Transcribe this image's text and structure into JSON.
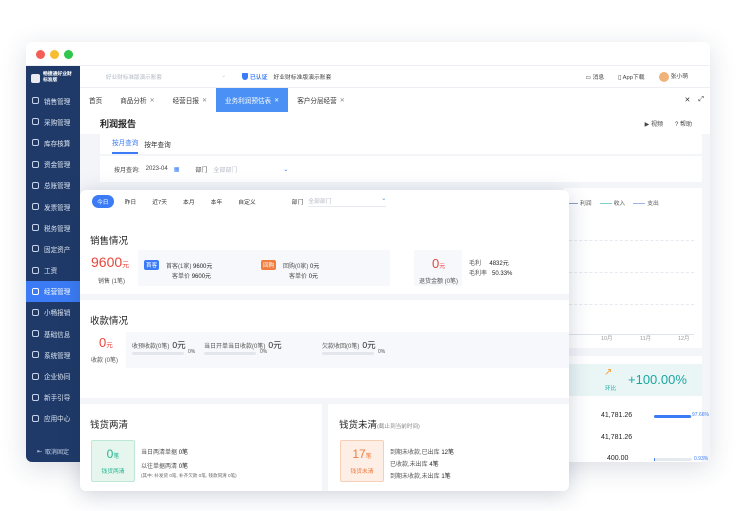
{
  "sidebar": {
    "logo_line1": "畅捷通好业财",
    "logo_line2": "标准版",
    "items": [
      {
        "label": "销售管理"
      },
      {
        "label": "采购管理"
      },
      {
        "label": "库存核算"
      },
      {
        "label": "资金管理"
      },
      {
        "label": "总账管理"
      },
      {
        "label": "发票管理"
      },
      {
        "label": "税务管理"
      },
      {
        "label": "固定资产"
      },
      {
        "label": "工资"
      },
      {
        "label": "经营管理"
      },
      {
        "label": "小畅报销"
      },
      {
        "label": "基础信息"
      },
      {
        "label": "系统管理"
      },
      {
        "label": "企业协同"
      },
      {
        "label": "新手引导"
      },
      {
        "label": "应用中心"
      }
    ],
    "active_index": 9,
    "footer": "取消固定"
  },
  "topbar": {
    "account_select": "好业财标准版演示账套",
    "certified": "已认证",
    "demo_name": "好业财标准版演示账套",
    "messages": "消息",
    "app_download": "App下载",
    "user_name": "张小萌"
  },
  "tabs": [
    {
      "label": "首页",
      "closable": false
    },
    {
      "label": "商品分析",
      "closable": true
    },
    {
      "label": "经营日报",
      "closable": true
    },
    {
      "label": "业务利润预估表",
      "closable": true,
      "active": true
    },
    {
      "label": "客户分层经营",
      "closable": true
    }
  ],
  "report": {
    "title": "利润报告",
    "video": "视频",
    "help": "帮助",
    "sub_tabs": [
      "按月查询",
      "按年查询"
    ],
    "filter_label": "按月查询:",
    "filter_month": "2023-04",
    "dept_label": "部门",
    "dept_placeholder": "全部部门"
  },
  "background_chart": {
    "legend": [
      "利润",
      "收入",
      "支出"
    ],
    "x_ticks": [
      "10月",
      "11月",
      "12月"
    ]
  },
  "background_stats": {
    "ratio_label": "环比",
    "ratio_value": "+100.00%",
    "rows": [
      {
        "value": "41,781.26",
        "pct": "97.66%",
        "fraction": 0.9766
      },
      {
        "value": "41,781.26",
        "pct": "",
        "fraction": 0
      },
      {
        "value": "400.00",
        "pct": "0.93%",
        "fraction": 0.0093
      }
    ]
  },
  "dashboard": {
    "periods": [
      "今日",
      "昨日",
      "近7天",
      "本月",
      "本年",
      "自定义"
    ],
    "active_period": 0,
    "dept_label": "部门",
    "dept_placeholder": "全部部门",
    "sales": {
      "title": "销售情况",
      "amount_num": "9600",
      "amount_unit": "元",
      "amount_sub": "销售 (1笔)",
      "tag_first": "首客",
      "first_label": "首客(1家)",
      "first_value": "9600元",
      "first_price_label": "客单价",
      "first_price": "9600元",
      "tag_repeat": "回购",
      "repeat_label": "回购(0家)",
      "repeat_value": "0元",
      "repeat_price_label": "客单价",
      "repeat_price": "0元",
      "return_num": "0",
      "return_unit": "元",
      "return_sub": "退货金额 (0笔)",
      "gross_profit_label": "毛利",
      "gross_profit": "4832元",
      "gross_margin_label": "毛利率",
      "gross_margin": "50.33%"
    },
    "receipts": {
      "title": "收款情况",
      "amount_num": "0",
      "amount_unit": "元",
      "amount_sub": "收款 (0笔)",
      "items": [
        {
          "label": "收预收款(0笔)",
          "value": "0元",
          "pct": "0%",
          "fraction": 0
        },
        {
          "label": "当日开单当日收款(0笔)",
          "value": "0元",
          "pct": "0%",
          "fraction": 0
        },
        {
          "label": "欠款收回(0笔)",
          "value": "0元",
          "pct": "0%",
          "fraction": 0
        }
      ]
    },
    "settled": {
      "title": "钱货两清",
      "count_num": "0",
      "count_unit": "笔",
      "badge": "钱货两清",
      "line1_label": "当日两清单据",
      "line1_value": "0笔",
      "line2_label": "以往单据两清",
      "line2_value": "0笔",
      "line3": "(其中: 补发货 0笔, 补齐欠款 0笔, 钱款同清 0笔)"
    },
    "unsettled": {
      "title": "钱货未清",
      "subtitle": "(截止到当前时间)",
      "count_num": "17",
      "count_unit": "笔",
      "badge": "钱货未清",
      "line1_label": "到期未收款,已出库",
      "line1_value": "12笔",
      "line2_label": "已收款,未出库",
      "line2_value": "4笔",
      "line3_label": "到期未收款,未出库",
      "line3_value": "1笔"
    }
  },
  "colors": {
    "sidebar_bg": "#1f3a68",
    "accent": "#3b7cf6",
    "tab_active": "#4a90f5",
    "red": "#e8453c",
    "green": "#25b58f",
    "orange": "#f07c3e",
    "teal": "#1aa7a0"
  }
}
